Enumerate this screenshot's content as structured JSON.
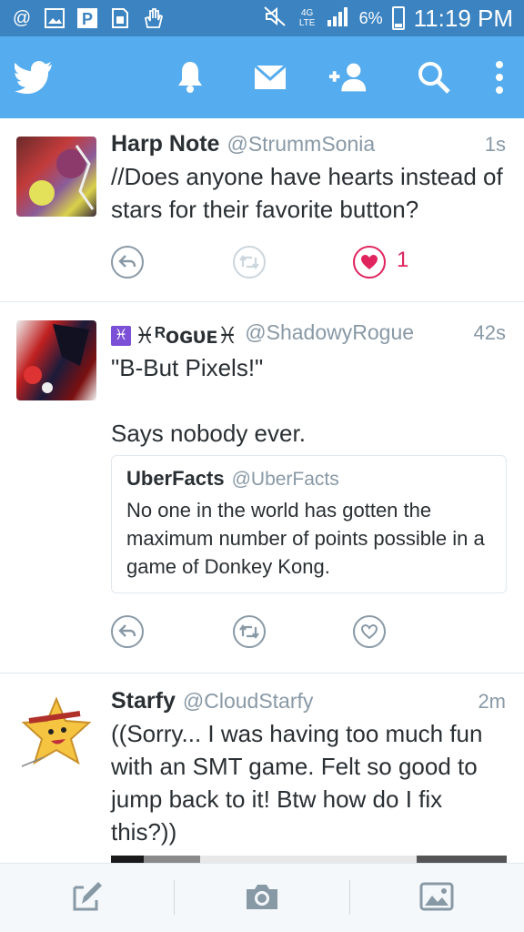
{
  "status_bar": {
    "left_icons": [
      "at-icon",
      "image-icon",
      "p-badge-icon",
      "sim-icon",
      "hand-icon"
    ],
    "network": "4G LTE",
    "battery": "6%",
    "time": "11:19 PM"
  },
  "top_bar": {
    "icons": [
      "twitter-bird-icon",
      "bell-icon",
      "envelope-icon",
      "add-user-icon",
      "search-icon",
      "overflow-menu-icon"
    ]
  },
  "tweets": [
    {
      "name": "Harp Note",
      "handle": "@StrummSonia",
      "time": "1s",
      "text": "//Does anyone have hearts instead of stars for their favorite button?",
      "like_count": "1",
      "liked": true
    },
    {
      "name": "♓ᴿᴏɢᴜᴇ♓",
      "handle": "@ShadowyRogue",
      "time": "42s",
      "text": "\"B-But Pixels!\"\n\nSays nobody ever.",
      "quote": {
        "name": "UberFacts",
        "handle": "@UberFacts",
        "text": "No one in the world has gotten the maximum number of points possible in a game of Donkey Kong."
      }
    },
    {
      "name": "Starfy",
      "handle": "@CloudStarfy",
      "time": "2m",
      "text": "((Sorry... I was having too much fun with an SMT game. Felt so good to jump back to it! Btw how do I fix this?))"
    }
  ],
  "bottom_bar": {
    "buttons": [
      "compose-icon",
      "camera-icon",
      "gallery-icon"
    ]
  },
  "colors": {
    "brand_blue": "#55acee",
    "status_blue": "#3b83c1",
    "like_red": "#e0245e",
    "muted_gray": "#8899a6"
  }
}
